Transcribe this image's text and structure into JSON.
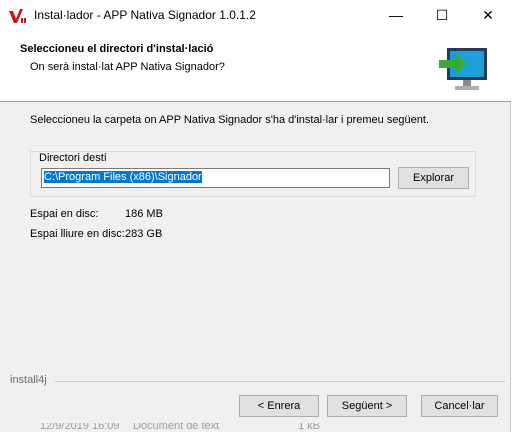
{
  "window": {
    "title": "Instal·lador - APP Nativa Signador 1.0.1.2",
    "controls": {
      "minimize": "—",
      "maximize": "☐",
      "close": "✕"
    }
  },
  "header": {
    "title": "Seleccioneu el directori d'instal·lació",
    "subtitle": "On serà instal·lat APP Nativa Signador?",
    "icon": "monitor-arrow-icon"
  },
  "content": {
    "instruction": "Seleccioneu la carpeta on APP Nativa Signador s'ha d'instal·lar i premeu següent.",
    "destination_label": "Directori destí",
    "destination_value": "C:\\Program Files (x86)\\Signador",
    "browse_label": "Explorar",
    "disk_space_label": "Espai en disc:",
    "disk_space_value": "186 MB",
    "free_space_label": "Espai lliure en disc:",
    "free_space_value": "283 GB"
  },
  "footer": {
    "brand": "install4j",
    "back_label": "< Enrera",
    "next_label": "Següent >",
    "cancel_label": "Cancel·lar"
  },
  "background_row": [
    "12/9/2019 16:09",
    "Document de text",
    "1 kB"
  ],
  "colors": {
    "selection": "#0078d7",
    "arrow": "#3aa83a",
    "screen": "#1ca0d8"
  }
}
